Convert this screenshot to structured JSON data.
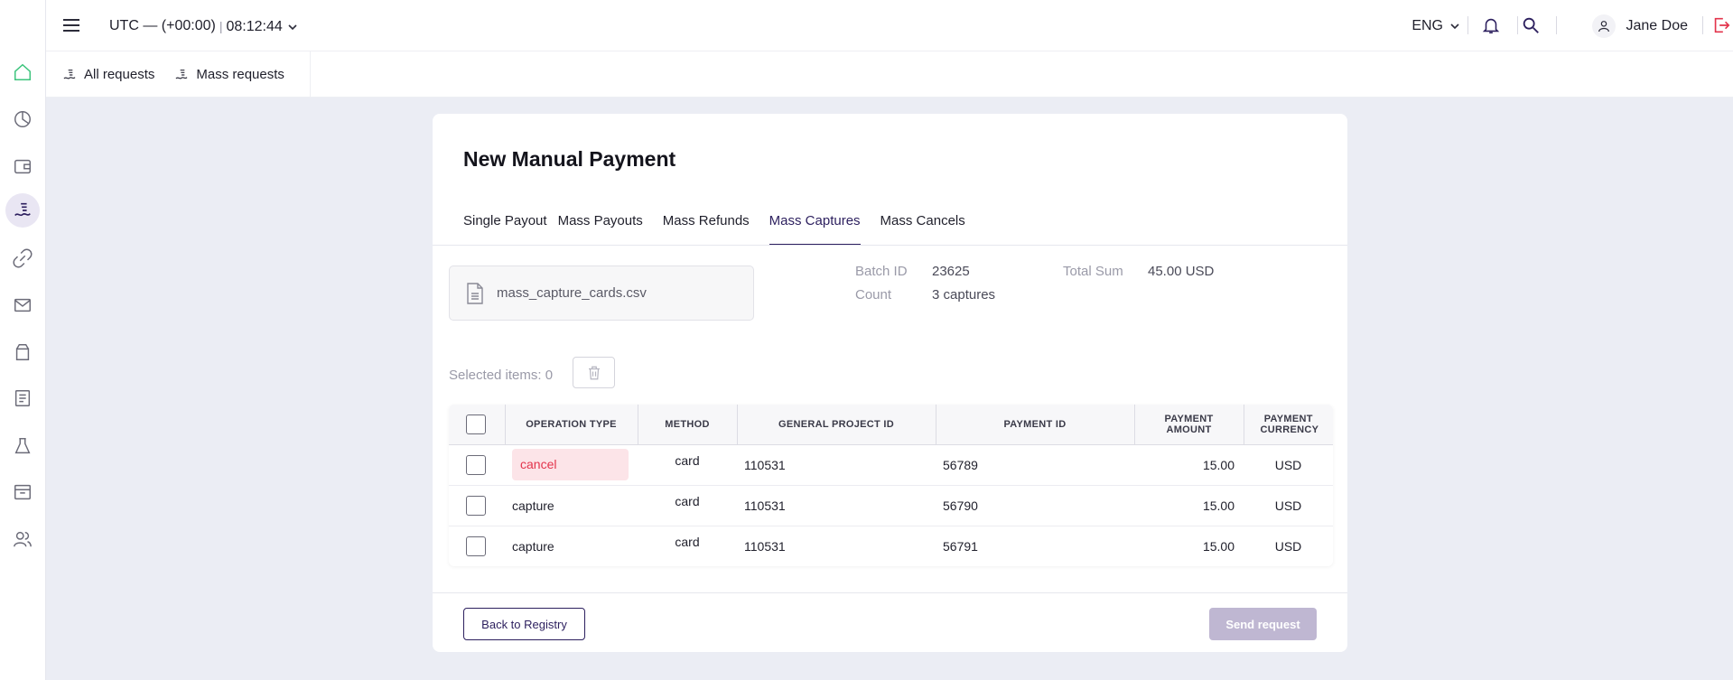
{
  "topbar": {
    "timezone": "UTC — (+00:00)",
    "separator": "|",
    "time": "08:12:44",
    "language": "ENG",
    "user_name": "Jane Doe"
  },
  "sidebar": {
    "items": [
      {
        "icon": "home-icon",
        "active": false
      },
      {
        "icon": "analytics-icon",
        "active": false
      },
      {
        "icon": "wallet-icon",
        "active": false
      },
      {
        "icon": "payouts-icon",
        "active": true
      },
      {
        "icon": "link-icon",
        "active": false
      },
      {
        "icon": "mail-icon",
        "active": false
      },
      {
        "icon": "shopping-bag-icon",
        "active": false
      },
      {
        "icon": "document-icon",
        "active": false
      },
      {
        "icon": "flask-icon",
        "active": false
      },
      {
        "icon": "archive-icon",
        "active": false
      },
      {
        "icon": "users-icon",
        "active": false
      }
    ]
  },
  "subnav": {
    "all_requests": "All requests",
    "mass_requests": "Mass requests"
  },
  "card": {
    "title": "New Manual Payment",
    "tabs": [
      "Single Payout",
      "Mass Payouts",
      "Mass Refunds",
      "Mass Captures",
      "Mass Cancels"
    ],
    "active_tab": "Mass Captures",
    "file_name": "mass_capture_cards.csv",
    "batch_id_label": "Batch ID",
    "batch_id": "23625",
    "count_label": "Count",
    "count": "3 captures",
    "total_sum_label": "Total Sum",
    "total_sum": "45.00 USD",
    "selected_items": "Selected items: 0"
  },
  "table": {
    "headers": {
      "operation_type": "OPERATION TYPE",
      "method": "METHOD",
      "general_project_id": "GENERAL PROJECT ID",
      "payment_id": "PAYMENT ID",
      "payment_amount": "PAYMENT AMOUNT",
      "payment_currency": "PAYMENT CURRENCY"
    },
    "rows": [
      {
        "operation_type": "cancel",
        "method": "card",
        "general_project_id": "110531",
        "payment_id": "56789",
        "amount": "15.00",
        "currency": "USD"
      },
      {
        "operation_type": "capture",
        "method": "card",
        "general_project_id": "110531",
        "payment_id": "56790",
        "amount": "15.00",
        "currency": "USD"
      },
      {
        "operation_type": "capture",
        "method": "card",
        "general_project_id": "110531",
        "payment_id": "56791",
        "amount": "15.00",
        "currency": "USD"
      }
    ]
  },
  "footer": {
    "back_label": "Back to Registry",
    "send_label": "Send request"
  },
  "colors": {
    "accent": "#2c1f5e",
    "error": "#e3344c",
    "home_green": "#3cc47c",
    "logout_red": "#e3344c"
  }
}
